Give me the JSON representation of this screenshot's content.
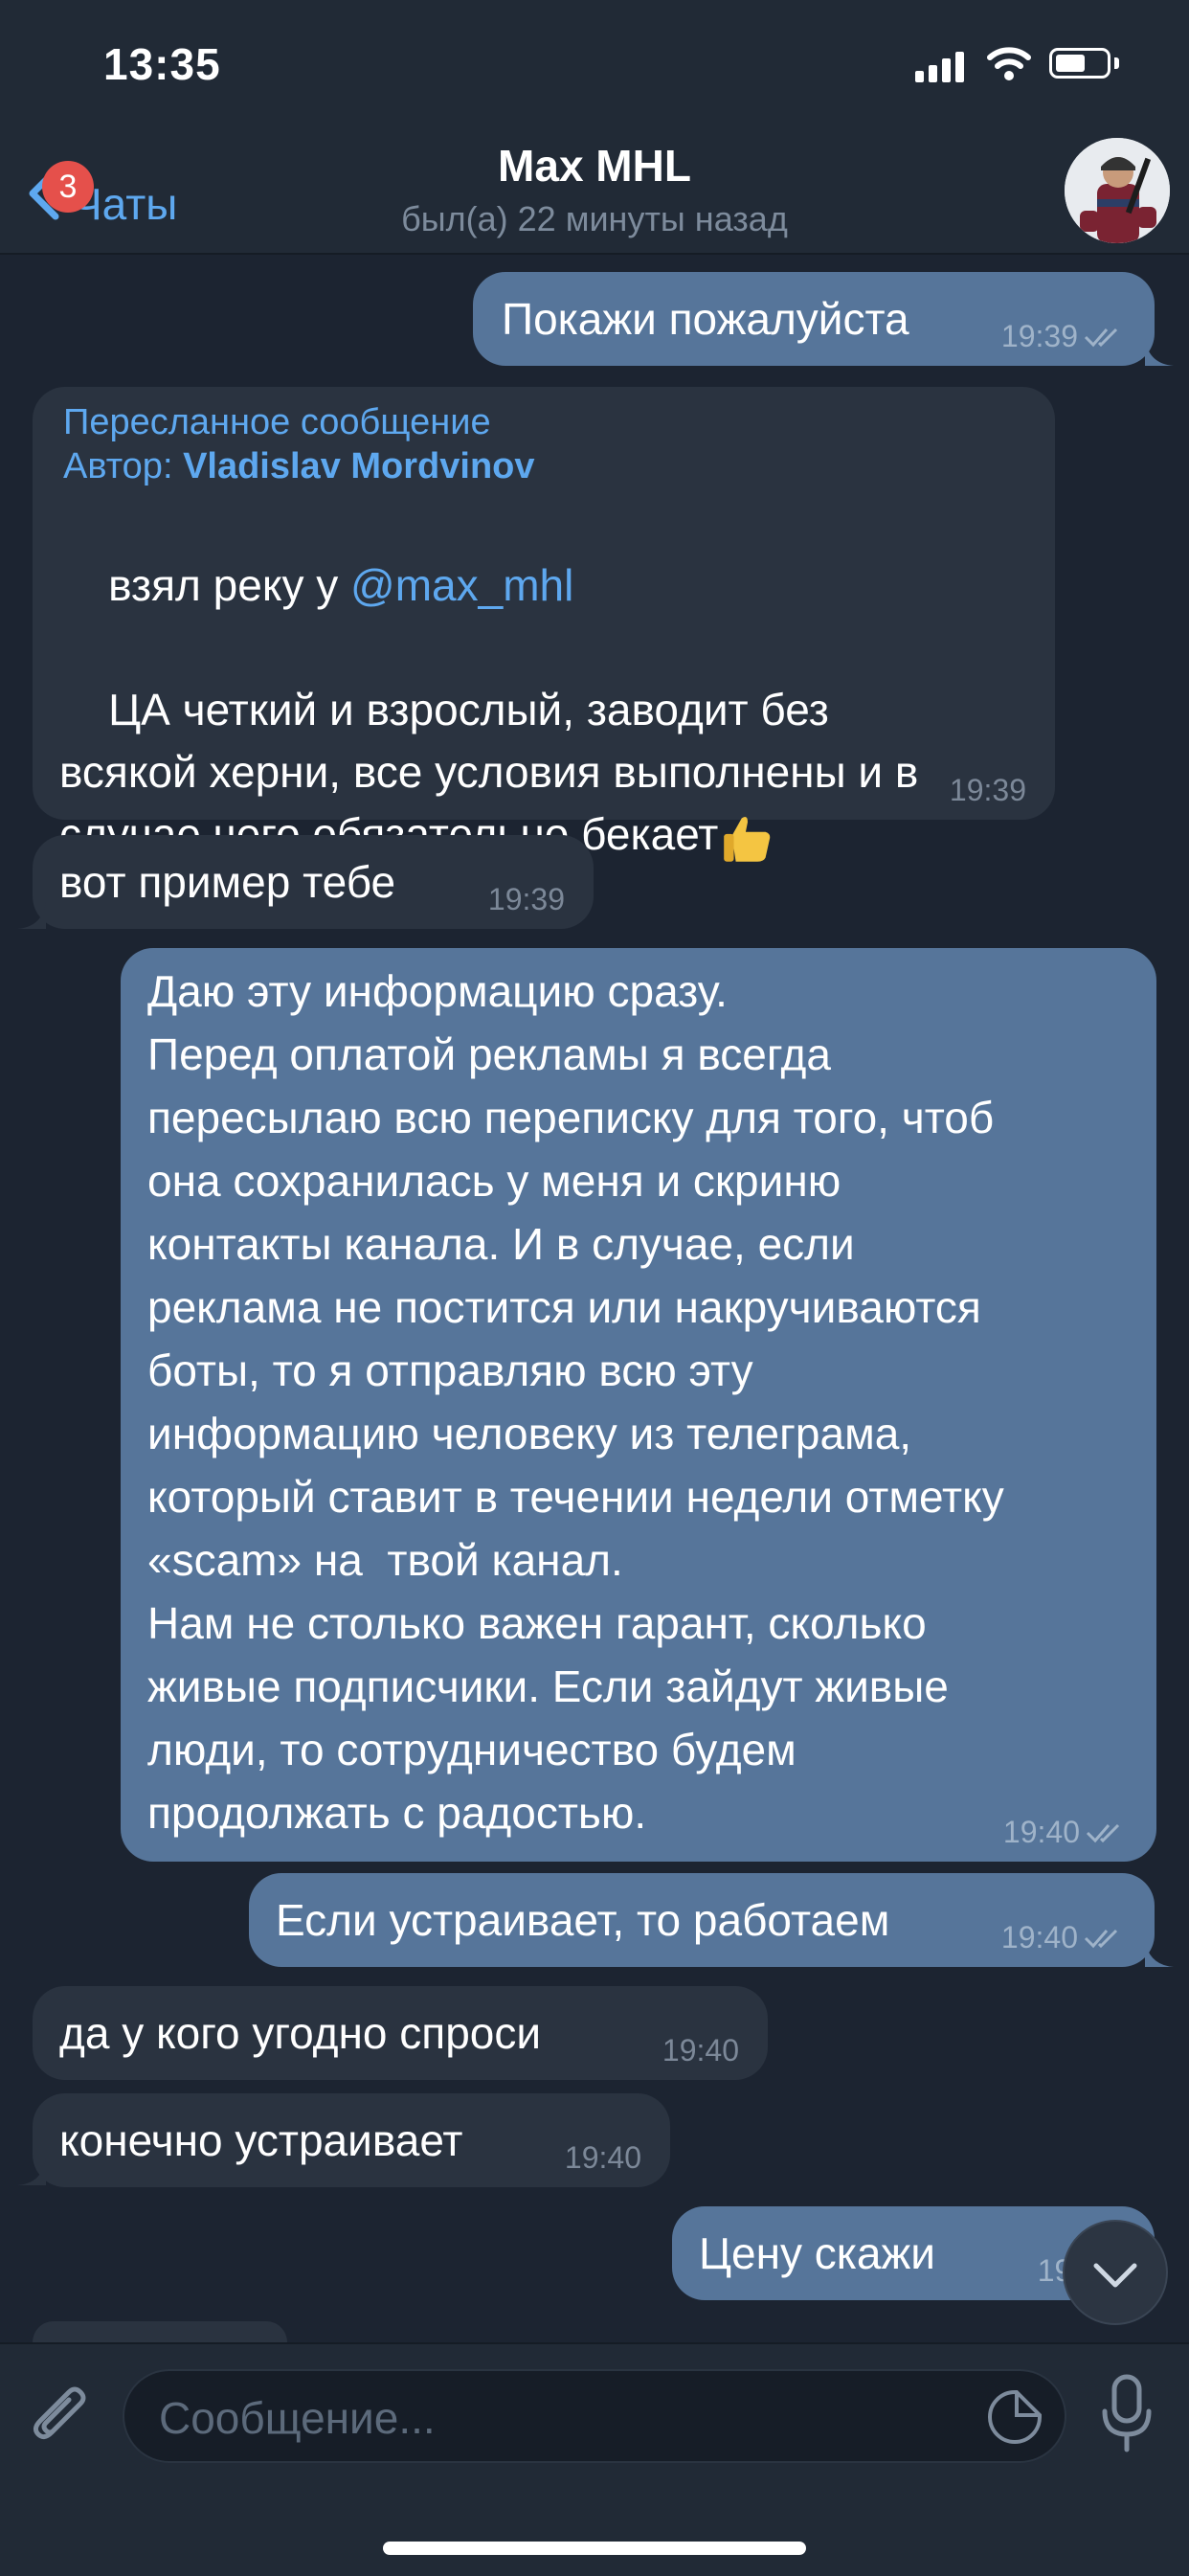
{
  "status_bar": {
    "time": "13:35"
  },
  "header": {
    "back_label": "Чаты",
    "unread_badge": "3",
    "title": "Max MHL",
    "last_seen": "был(а) 22 минуты назад"
  },
  "messages": [
    {
      "dir": "out",
      "text": "Покажи пожалуйста",
      "time": "19:39"
    },
    {
      "dir": "in",
      "forward_label": "Пересланное сообщение",
      "forward_author_prefix": "Автор: ",
      "forward_author": "Vladislav Mordvinov",
      "text_before_mention": "взял реку у ",
      "mention": "@max_mhl",
      "text_after": "ЦА четкий и взрослый, заводит без\nвсякой херни, все условия выполнены и в\nслучае чего обязательно бекает",
      "time": "19:39"
    },
    {
      "dir": "in",
      "text": "вот пример тебе",
      "time": "19:39"
    },
    {
      "dir": "out",
      "text": "Даю эту информацию сразу.\nПеред оплатой рекламы я всегда\nпересылаю всю переписку для того, чтоб\nона сохранилась у меня и скриню\nконтакты канала. И в случае, если\nреклама не постится или накручиваются\nботы, то я отправляю всю эту\nинформацию человеку из телеграма,\nкоторый ставит в течении недели отметку\n«scam» на  твой канал.\nНам не столько важен гарант, сколько\nживые подписчики. Если зайдут живые\nлюди, то сотрудничество будем\nпродолжать с радостью.",
      "time": "19:40"
    },
    {
      "dir": "out",
      "text": "Если устраивает, то работаем",
      "time": "19:40"
    },
    {
      "dir": "in",
      "text": "да у кого угодно спроси",
      "time": "19:40"
    },
    {
      "dir": "in",
      "text": "конечно устраивает",
      "time": "19:40"
    },
    {
      "dir": "out",
      "text": "Цену скажи",
      "time": "19:4"
    }
  ],
  "composer": {
    "placeholder": "Сообщение..."
  },
  "colors": {
    "accent": "#5ea8ef",
    "bubble_out": "#56759a",
    "bubble_in": "#2a3340",
    "badge": "#e5504b",
    "background": "#1c2431"
  }
}
